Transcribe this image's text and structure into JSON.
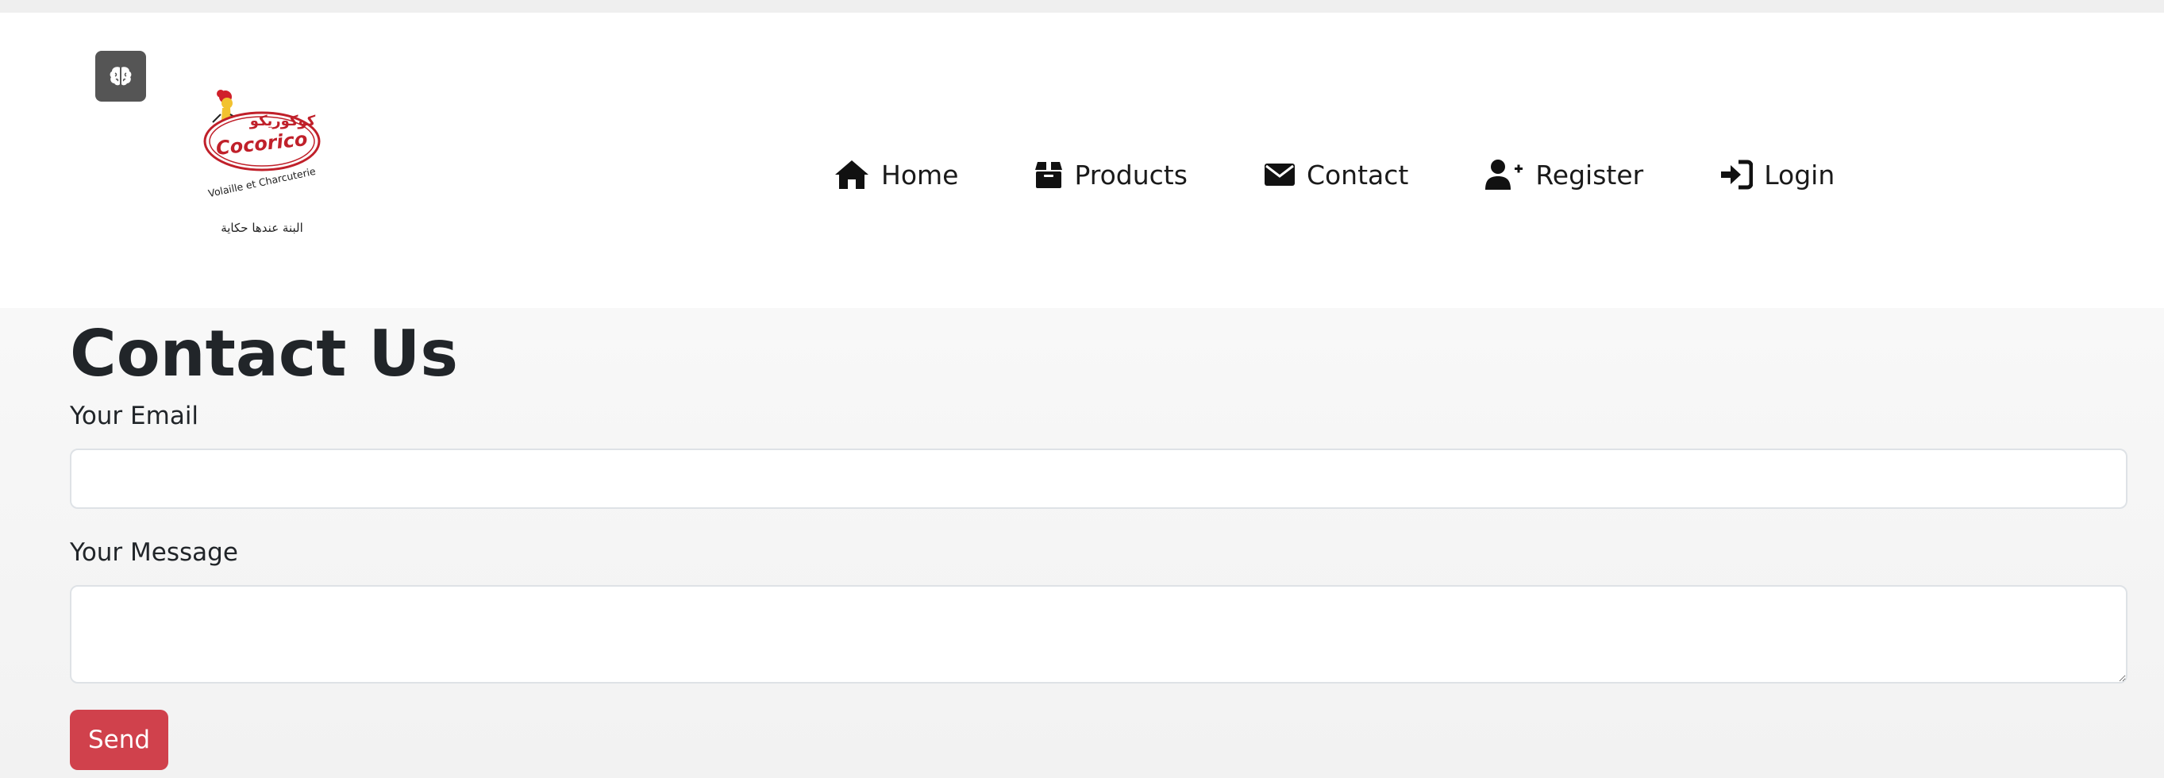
{
  "header": {
    "logo": {
      "arabic_brand": "كوكوريكو",
      "brand": "Cocorico",
      "tagline": "Volaille et Charcuterie",
      "slogan": "البنة عندها حكاية"
    },
    "nav": [
      {
        "label": "Home",
        "icon": "home-icon"
      },
      {
        "label": "Products",
        "icon": "box-icon"
      },
      {
        "label": "Contact",
        "icon": "envelope-icon"
      },
      {
        "label": "Register",
        "icon": "user-plus-icon"
      },
      {
        "label": "Login",
        "icon": "sign-in-icon"
      }
    ]
  },
  "main": {
    "title": "Contact Us",
    "email_label": "Your Email",
    "email_value": "",
    "message_label": "Your Message",
    "message_value": "",
    "send_label": "Send"
  },
  "colors": {
    "accent": "#d0414c",
    "brain_button": "#555555"
  }
}
